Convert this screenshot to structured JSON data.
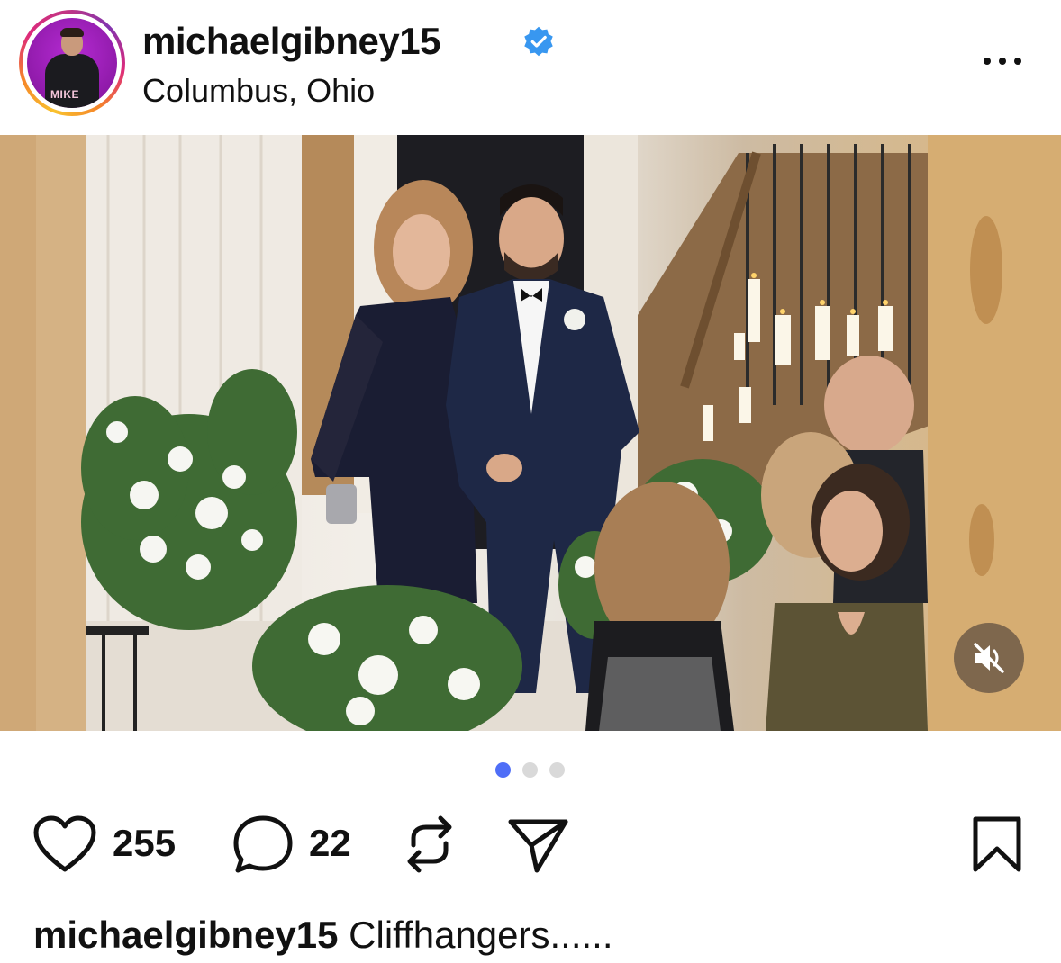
{
  "post": {
    "username": "michaelgibney15",
    "location": "Columbus, Ohio",
    "avatar_tag": "MIKE",
    "verified": true
  },
  "media": {
    "type": "carousel-video",
    "current_index": 1,
    "total": 3,
    "muted": true
  },
  "actions": {
    "likes": "255",
    "comments": "22"
  },
  "caption": {
    "username": "michaelgibney15",
    "text": "Cliffhangers......"
  },
  "icons": {
    "verified": "verified-badge-icon",
    "more": "more-horizontal-icon",
    "like": "heart-icon",
    "comment": "comment-bubble-icon",
    "repost": "repost-icon",
    "share": "send-icon",
    "save": "bookmark-icon",
    "mute": "speaker-muted-icon"
  },
  "colors": {
    "verified_blue": "#3897f0",
    "active_dot": "#4f6ef7",
    "inactive_dot": "#d9d9d9",
    "text": "#111111"
  }
}
